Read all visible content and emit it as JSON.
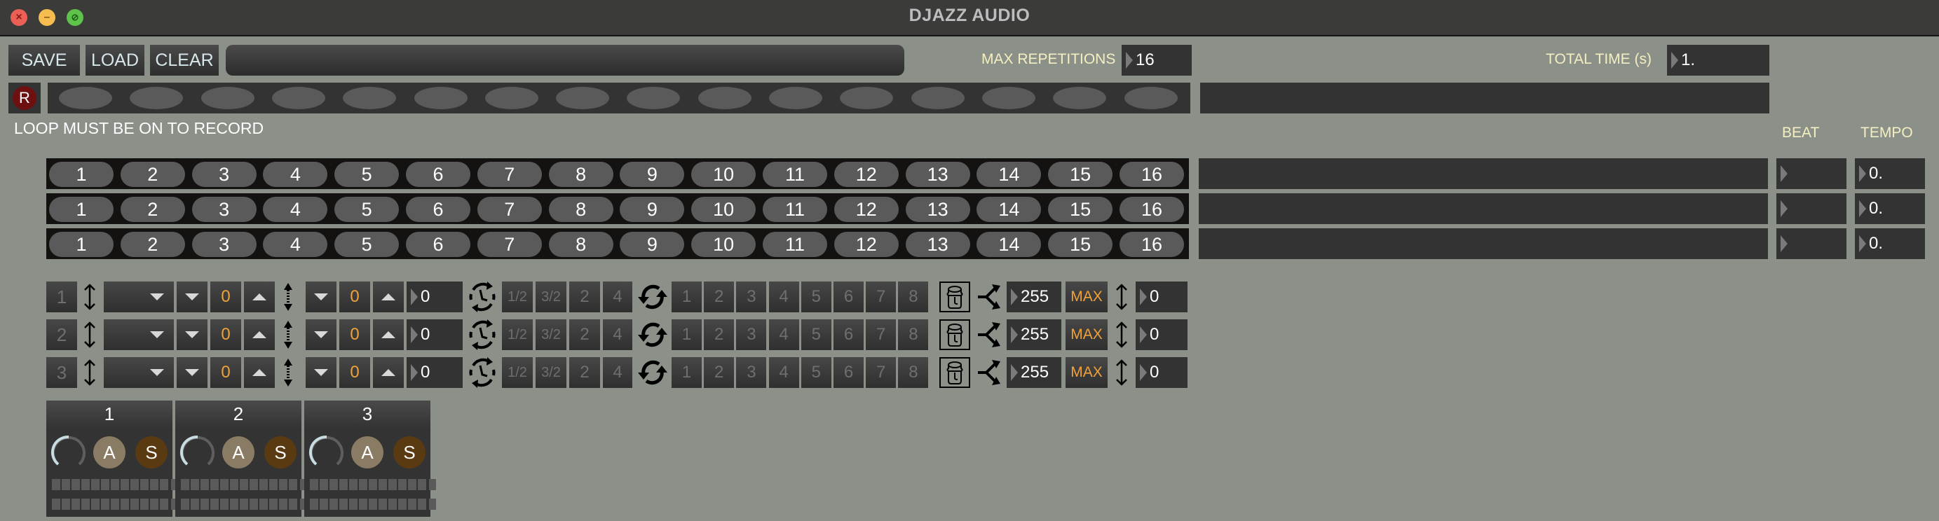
{
  "window": {
    "title": "DJAZZ AUDIO",
    "controls": {
      "close": "close-icon",
      "minimize": "minimize-icon",
      "zoom": "zoom-icon"
    }
  },
  "toolbar": {
    "save_label": "SAVE",
    "load_label": "LOAD",
    "clear_label": "CLEAR",
    "filename_value": "",
    "max_repetitions_label": "MAX REPETITIONS",
    "max_repetitions_value": "16",
    "total_time_label": "TOTAL TIME (s)",
    "total_time_value": "1."
  },
  "record": {
    "button_label": "R",
    "slot_count": 16,
    "status_text": "LOOP MUST BE ON TO RECORD"
  },
  "loops": {
    "beat_label": "BEAT",
    "tempo_label": "TEMPO",
    "rows": [
      {
        "steps": [
          "1",
          "2",
          "3",
          "4",
          "5",
          "6",
          "7",
          "8",
          "9",
          "10",
          "11",
          "12",
          "13",
          "14",
          "15",
          "16"
        ],
        "beat": "",
        "tempo": "0."
      },
      {
        "steps": [
          "1",
          "2",
          "3",
          "4",
          "5",
          "6",
          "7",
          "8",
          "9",
          "10",
          "11",
          "12",
          "13",
          "14",
          "15",
          "16"
        ],
        "beat": "",
        "tempo": "0."
      },
      {
        "steps": [
          "1",
          "2",
          "3",
          "4",
          "5",
          "6",
          "7",
          "8",
          "9",
          "10",
          "11",
          "12",
          "13",
          "14",
          "15",
          "16"
        ],
        "beat": "",
        "tempo": "0."
      }
    ]
  },
  "tracks": [
    {
      "index": "1",
      "dropdown": "",
      "transpose": "0",
      "offset": "0",
      "offset_num": "0",
      "speeds": [
        "1/2",
        "3/2",
        "2",
        "4"
      ],
      "repeats": [
        "1",
        "2",
        "3",
        "4",
        "5",
        "6",
        "7",
        "8"
      ],
      "velocity": "255",
      "max_label": "MAX",
      "shift": "0"
    },
    {
      "index": "2",
      "dropdown": "",
      "transpose": "0",
      "offset": "0",
      "offset_num": "0",
      "speeds": [
        "1/2",
        "3/2",
        "2",
        "4"
      ],
      "repeats": [
        "1",
        "2",
        "3",
        "4",
        "5",
        "6",
        "7",
        "8"
      ],
      "velocity": "255",
      "max_label": "MAX",
      "shift": "0"
    },
    {
      "index": "3",
      "dropdown": "",
      "transpose": "0",
      "offset": "0",
      "offset_num": "0",
      "speeds": [
        "1/2",
        "3/2",
        "2",
        "4"
      ],
      "repeats": [
        "1",
        "2",
        "3",
        "4",
        "5",
        "6",
        "7",
        "8"
      ],
      "velocity": "255",
      "max_label": "MAX",
      "shift": "0"
    }
  ],
  "channels": [
    {
      "label": "1",
      "a_label": "A",
      "s_label": "S",
      "knob_level": 0.0
    },
    {
      "label": "2",
      "a_label": "A",
      "s_label": "S",
      "knob_level": 0.0
    },
    {
      "label": "3",
      "a_label": "A",
      "s_label": "S",
      "knob_level": 0.0
    }
  ],
  "colors": {
    "background": "#8b9089",
    "accent_orange": "#f0a23a",
    "label_cream": "#f4efc1",
    "record_red": "#6e1010",
    "a_button": "#8a7c64",
    "s_button": "#5a3a10"
  }
}
